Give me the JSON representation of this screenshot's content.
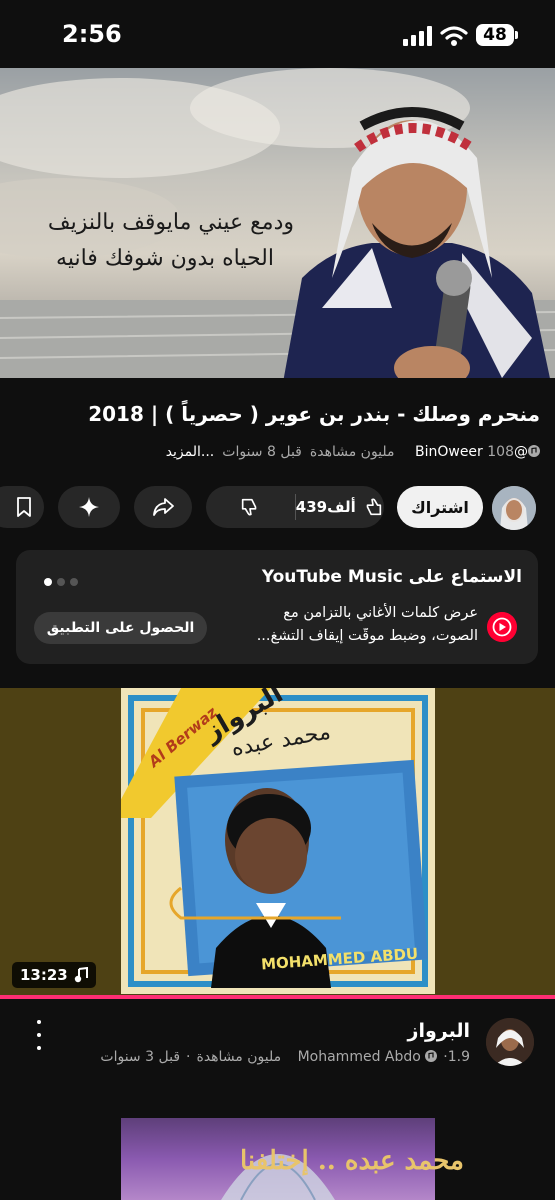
{
  "status_bar": {
    "time": "2:56",
    "battery": "48"
  },
  "hero_video": {
    "lyric_line_1": "ودمع عيني مايوقف بالنزيف",
    "lyric_line_2": "الحياه بدون شوفك فانيه"
  },
  "video": {
    "title": "منحرم وصلك - بندر بن عوير ( حصرياً ) | 2018",
    "channel_handle": "@BinOweer",
    "views": "108 مليون مشاهدة",
    "age": "قبل 8 سنوات",
    "more": "...المزيد"
  },
  "actions": {
    "subscribe": "اشتراك",
    "like_count": "439ألف"
  },
  "music_card": {
    "heading": "الاستماع على YouTube Music",
    "desc_line_1": "عرض كلمات الأغاني بالتزامن مع",
    "desc_line_2": "الصوت، وضبط موقّت إيقاف التشغ...",
    "get_app": "الحصول على التطبيق",
    "page_indicator": {
      "count": 3,
      "active": 1
    }
  },
  "next_video": {
    "album_title_ar": "البرواز",
    "album_title_en": "Al Berwaz",
    "album_artist_ar": "محمد عبده",
    "album_artist_en": "MOHAMMED ABDU",
    "duration": "13:23",
    "title": "البرواز",
    "channel": "Mohammed Abdo",
    "views": "1.9 مليون مشاهدة",
    "age": "قبل 3 سنوات",
    "watched_fraction": 1.0
  },
  "third_video": {
    "thumb_text": "محمد عبده .. إختلفنا"
  },
  "colors": {
    "background": "#0f0f0f",
    "accent_red": "#ff0033",
    "progress": "#ff2e74"
  }
}
